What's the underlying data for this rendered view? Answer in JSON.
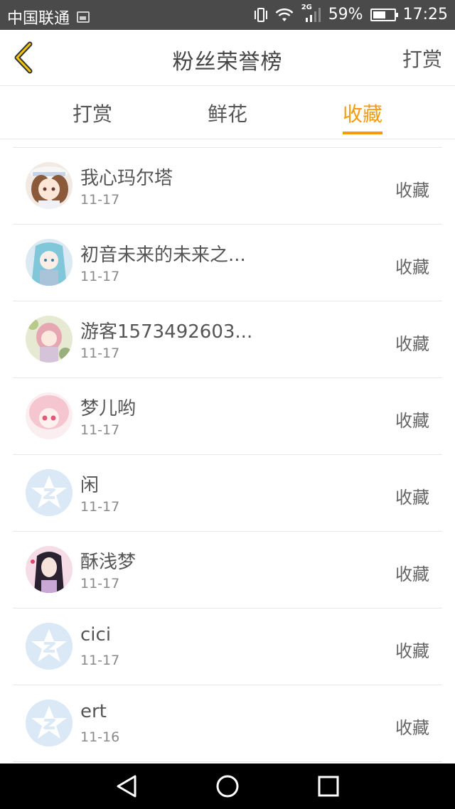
{
  "status_bar": {
    "carrier": "中国联通",
    "network": "2G",
    "battery": "59%",
    "battery_level": 0.59,
    "time": "17:25"
  },
  "header": {
    "title": "粉丝荣誉榜",
    "right_action": "打赏",
    "back_icon": "chevron-left-icon"
  },
  "tabs": [
    {
      "label": "打赏",
      "active": false
    },
    {
      "label": "鲜花",
      "active": false
    },
    {
      "label": "收藏",
      "active": true
    }
  ],
  "list": [
    {
      "name": "我心玛尔塔",
      "date": "11-17",
      "action": "收藏",
      "avatar": "anime-girl-white-hat"
    },
    {
      "name": "初音未来的未来之...",
      "date": "11-17",
      "action": "收藏",
      "avatar": "anime-miku"
    },
    {
      "name": "游客1573492603...",
      "date": "11-17",
      "action": "收藏",
      "avatar": "anime-girl-pink-hair"
    },
    {
      "name": "梦儿哟",
      "date": "11-17",
      "action": "收藏",
      "avatar": "anime-girl-pink-eyes"
    },
    {
      "name": "闲",
      "date": "11-17",
      "action": "收藏",
      "avatar": "default-qq-avatar"
    },
    {
      "name": "酥浅梦",
      "date": "11-17",
      "action": "收藏",
      "avatar": "girl-black-hair"
    },
    {
      "name": "cici",
      "date": "11-17",
      "action": "收藏",
      "avatar": "default-qq-avatar"
    },
    {
      "name": "ert",
      "date": "11-16",
      "action": "收藏",
      "avatar": "default-qq-avatar"
    }
  ],
  "colors": {
    "accent": "#f39c11",
    "status_bar": "#4a4a4a",
    "nav_bar": "#000000"
  }
}
